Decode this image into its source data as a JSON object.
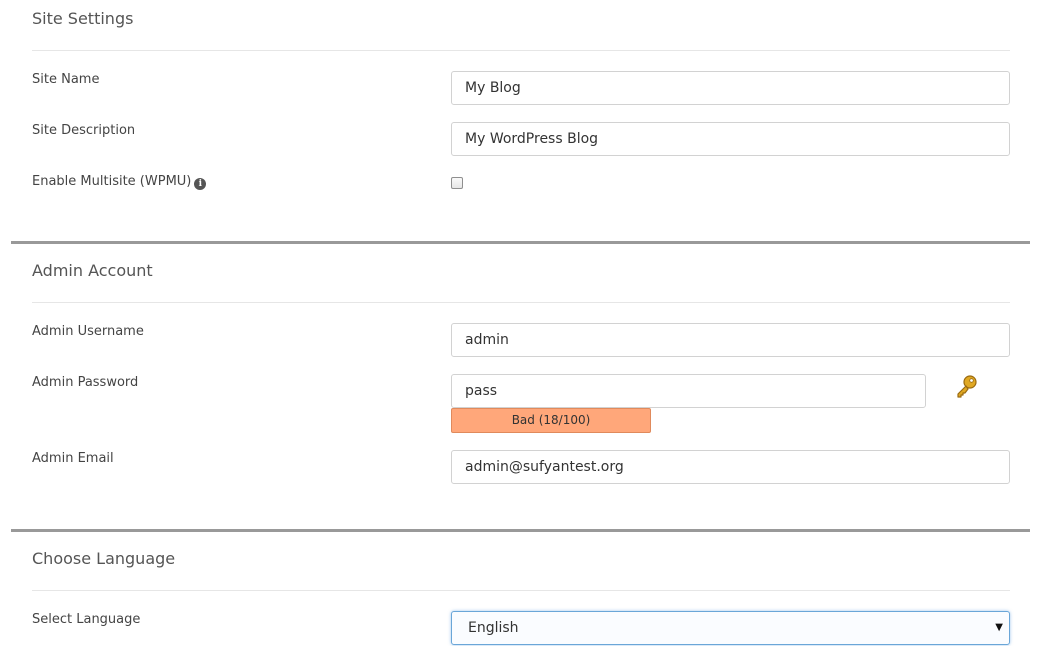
{
  "site_settings": {
    "title": "Site Settings",
    "site_name_label": "Site Name",
    "site_name_value": "My Blog",
    "site_description_label": "Site Description",
    "site_description_value": "My WordPress Blog",
    "multisite_label": "Enable Multisite (WPMU)",
    "multisite_info_glyph": "i",
    "multisite_checked": false
  },
  "admin_account": {
    "title": "Admin Account",
    "username_label": "Admin Username",
    "username_value": "admin",
    "password_label": "Admin Password",
    "password_value": "pass",
    "password_strength": "Bad (18/100)",
    "password_strength_score": 18,
    "password_strength_color": "#ffa77a",
    "generate_icon": "key-icon",
    "email_label": "Admin Email",
    "email_value": "admin@sufyantest.org"
  },
  "language": {
    "title": "Choose Language",
    "select_label": "Select Language",
    "selected_value": "English",
    "select_arrow": "▼"
  }
}
